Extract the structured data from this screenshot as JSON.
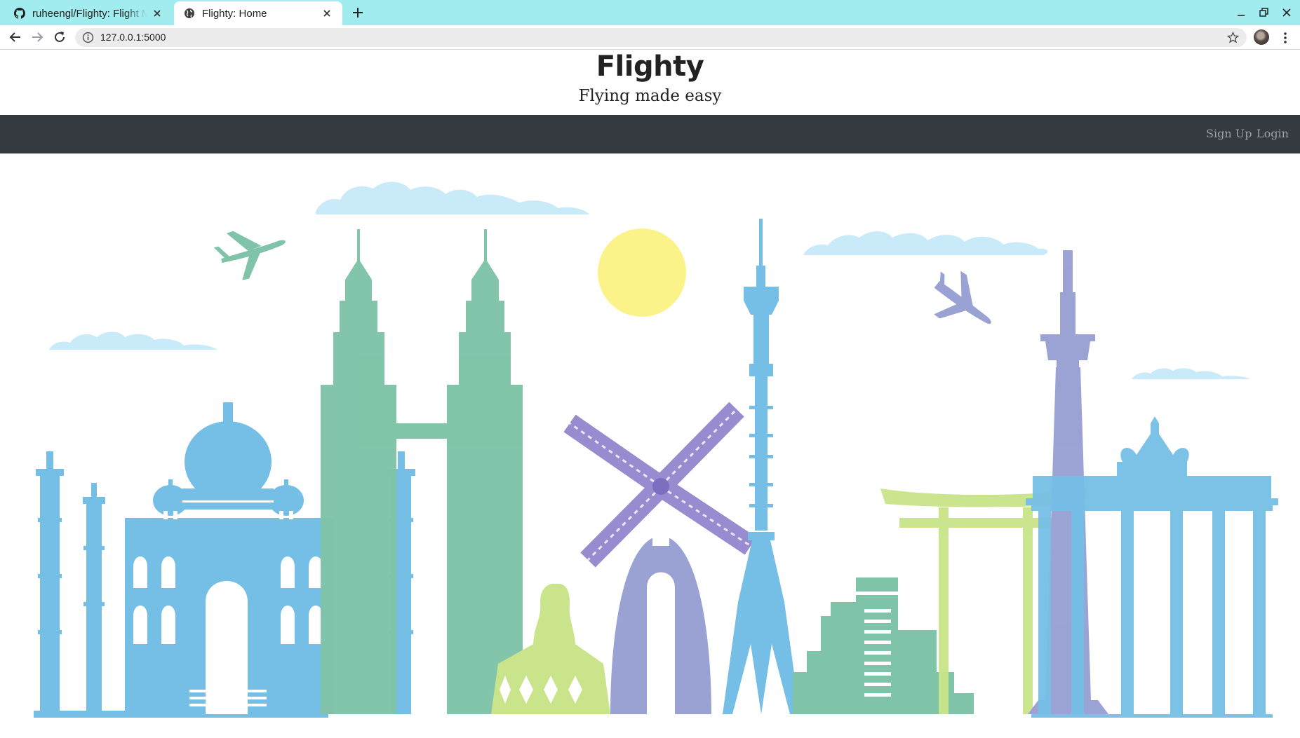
{
  "browser": {
    "tabs": [
      {
        "title": "ruheengl/Flighty: Flight M",
        "active": false,
        "icon": "github-icon"
      },
      {
        "title": "Flighty: Home",
        "active": true,
        "icon": "globe-icon"
      }
    ],
    "url": "127.0.0.1:5000"
  },
  "page": {
    "title": "Flighty",
    "tagline": "Flying made easy"
  },
  "nav": {
    "signup_label": "Sign Up",
    "login_label": "Login"
  },
  "hero": {
    "illustration": "world landmarks skyline",
    "colors": {
      "blue": "#75bfe6",
      "green": "#7fc4a8",
      "purple": "#9aa2d4",
      "lime": "#c9e48a",
      "sun": "#fbf38a",
      "cloud": "#c9eaf9"
    }
  }
}
